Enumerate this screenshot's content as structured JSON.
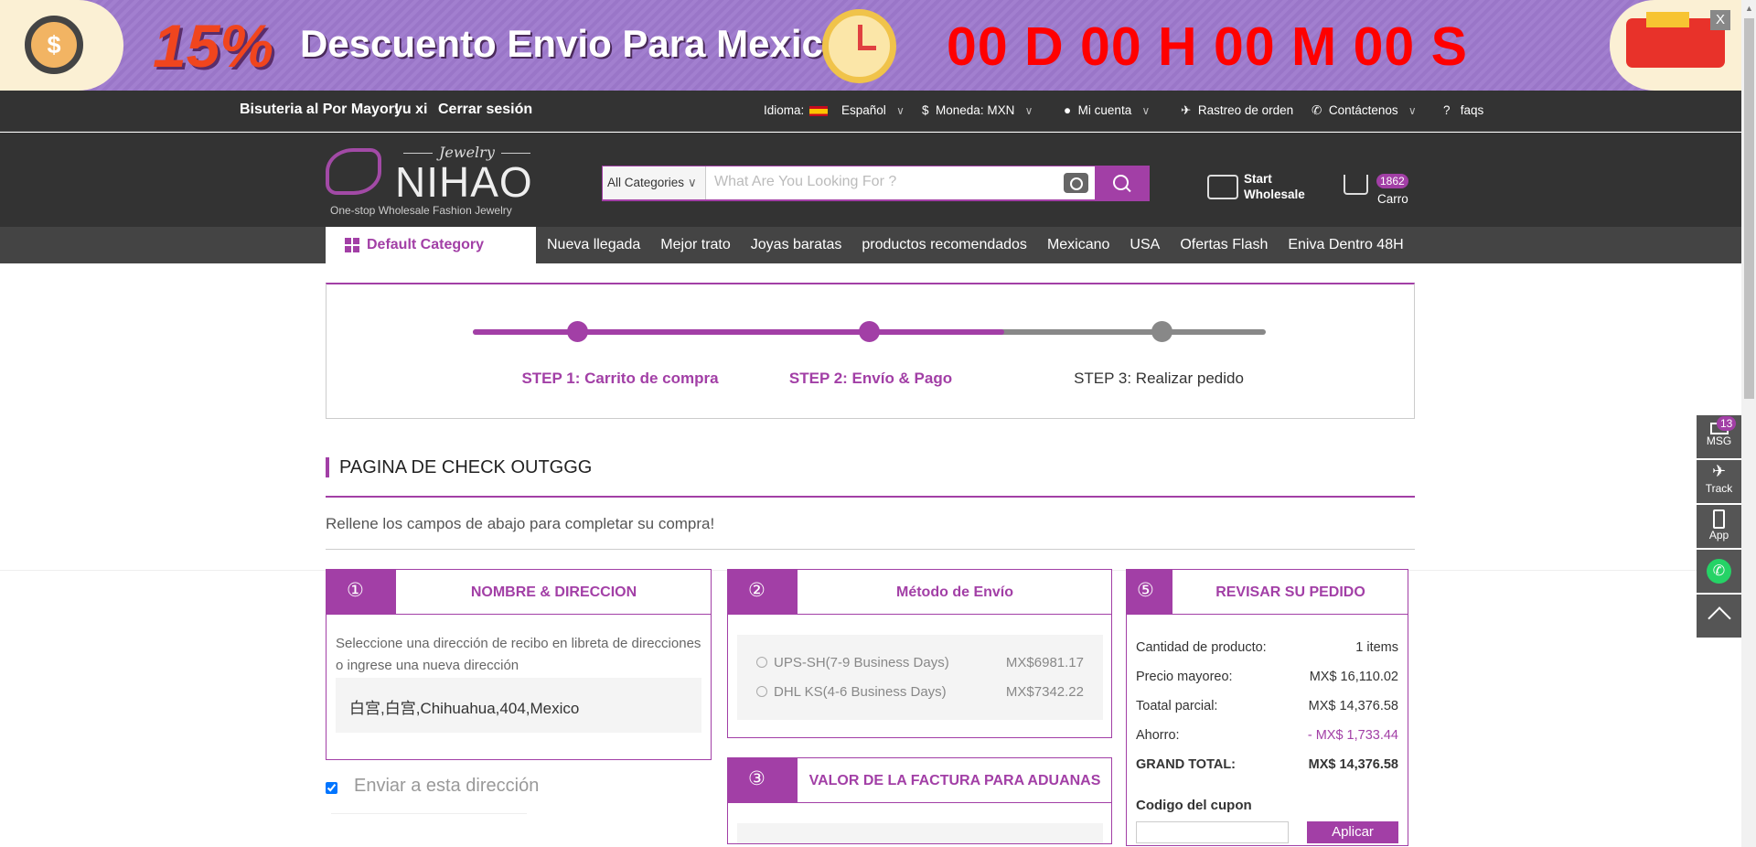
{
  "banner": {
    "percent": "15%",
    "title": "Descuento Envio Para Mexico",
    "countdown": "00 D 00 H 00 M 00 S",
    "close": "X",
    "coin": "$"
  },
  "topbar": {
    "greeting": "Bisuteria al Por Mayor!",
    "user": "yu xi",
    "logout": "Cerrar sesión",
    "language_label": "Idioma:",
    "language": "Español",
    "currency": "Moneda: MXN",
    "account": "Mi cuenta",
    "tracking": "Rastreo de orden",
    "contact": "Contáctenos",
    "faqs": "faqs"
  },
  "logo": {
    "jewelry": "Jewelry",
    "name": "NIHAO",
    "tagline": "One-stop Wholesale Fashion Jewelry"
  },
  "search": {
    "category": "All Categories",
    "placeholder": "What Are You Looking For ?"
  },
  "header": {
    "wholesale_line1": "Start",
    "wholesale_line2": "Wholesale",
    "cart_count": "1862",
    "cart_label": "Carro"
  },
  "nav": {
    "default": "Default Category",
    "items": [
      "Nueva llegada",
      "Mejor trato",
      "Joyas baratas",
      "productos recomendados",
      "Mexicano",
      "USA",
      "Ofertas Flash",
      "Eniva Dentro 48H"
    ]
  },
  "steps": {
    "progress": 0.67,
    "items": [
      "STEP 1: Carrito de compra",
      "STEP 2: Envío & Pago",
      "STEP 3: Realizar pedido"
    ]
  },
  "page": {
    "title": "PAGINA DE CHECK OUTGGG",
    "subtitle": "Rellene los campos de abajo para completar su compra!"
  },
  "address": {
    "num": "①",
    "title": "NOMBRE & DIRECCION",
    "hint": "Seleccione una dirección de recibo en libreta de direcciones o ingrese una nueva dirección",
    "value": "白宫,白宫,Chihuahua,404,Mexico",
    "ship_here": "Enviar a esta dirección"
  },
  "shipping": {
    "num": "②",
    "title": "Método de Envío",
    "options": [
      {
        "name": "UPS-SH(7-9 Business Days)",
        "price": "MX$6981.17"
      },
      {
        "name": "DHL KS(4-6 Business Days)",
        "price": "MX$7342.22"
      }
    ]
  },
  "customs": {
    "num": "③",
    "title": "VALOR DE LA FACTURA PARA ADUANAS"
  },
  "review": {
    "num": "⑤",
    "title": "REVISAR SU PEDIDO",
    "rows": [
      {
        "label": "Cantidad de producto:",
        "value": "1 items"
      },
      {
        "label": "Precio mayoreo:",
        "value": "MX$ 16,110.02"
      },
      {
        "label": "Toatal parcial:",
        "value": "MX$ 14,376.58"
      },
      {
        "label": "Ahorro:",
        "value": "- MX$ 1,733.44"
      },
      {
        "label": "GRAND TOTAL:",
        "value": "MX$ 14,376.58"
      }
    ],
    "coupon_label": "Codigo del cupon",
    "apply": "Aplicar"
  },
  "sidebar": {
    "msg": "MSG",
    "msg_count": "13",
    "track": "Track",
    "app": "App"
  },
  "colors": {
    "accent": "#a23fa6",
    "dark": "#333333"
  }
}
